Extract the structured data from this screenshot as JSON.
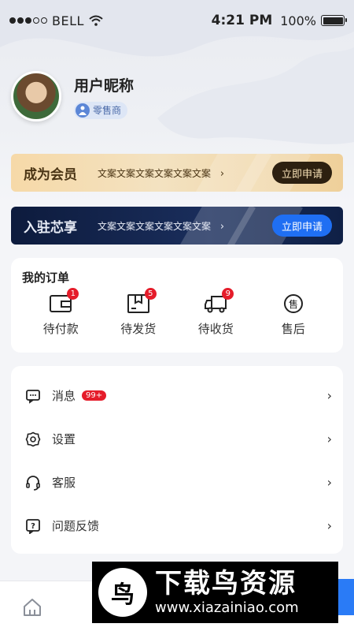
{
  "status_bar": {
    "carrier": "BELL",
    "time": "4:21 PM",
    "battery": "100%"
  },
  "profile": {
    "nickname": "用户昵称",
    "role": "零售商"
  },
  "banners": {
    "member": {
      "title": "成为会员",
      "desc": "文案文案文案文案文案文案",
      "button": "立即申请"
    },
    "join": {
      "title": "入驻芯享",
      "desc": "文案文案文案文案文案文案",
      "button": "立即申请"
    }
  },
  "orders": {
    "title": "我的订单",
    "items": [
      {
        "label": "待付款",
        "icon": "wallet-icon",
        "badge": "1"
      },
      {
        "label": "待发货",
        "icon": "box-icon",
        "badge": "5"
      },
      {
        "label": "待收货",
        "icon": "truck-icon",
        "badge": "9"
      },
      {
        "label": "售后",
        "icon": "after-sale-icon",
        "glyph": "售"
      }
    ]
  },
  "menu": {
    "items": [
      {
        "label": "消息",
        "icon": "message-icon",
        "badge": "99+"
      },
      {
        "label": "设置",
        "icon": "gear-icon"
      },
      {
        "label": "客服",
        "icon": "headset-icon"
      },
      {
        "label": "问题反馈",
        "icon": "feedback-icon"
      }
    ]
  },
  "watermark": {
    "title": "下载鸟资源",
    "url": "www.xiazainiao.com",
    "logo_glyph": "鸟"
  },
  "colors": {
    "accent_blue": "#1f6ff3",
    "badge_red": "#e51c2a",
    "gold": "#f3e2c1",
    "navy": "#0d1b3d"
  }
}
